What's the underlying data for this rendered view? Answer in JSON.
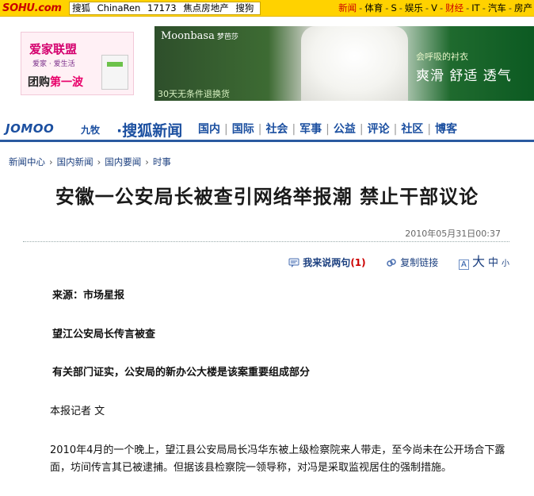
{
  "topbar": {
    "logo_prefix": "S",
    "logo_mid": "OHU",
    "logo_suffix": ".com",
    "left_links": [
      "搜狐",
      "ChinaRen",
      "17173",
      "焦点房地产",
      "搜狗"
    ],
    "right_links": [
      {
        "label": "新闻",
        "active": true
      },
      {
        "label": "体育",
        "active": false
      },
      {
        "label": "S",
        "active": false
      },
      {
        "label": "娱乐",
        "active": false
      },
      {
        "label": "V",
        "active": false
      },
      {
        "label": "财经",
        "active": true
      },
      {
        "label": "IT",
        "active": false
      },
      {
        "label": "汽车",
        "active": false
      },
      {
        "label": "房产",
        "active": false
      }
    ]
  },
  "ads": {
    "left": {
      "title": "爱家联盟",
      "tagline": "爱家 · 爱生活",
      "headline_a": "团购",
      "headline_b": "第一波"
    },
    "right": {
      "brand": "Moonbasa",
      "brand_cn": "梦芭莎",
      "subhead": "会呼吸的衬衣",
      "headline": "爽滑 舒适 透气",
      "footer": "30天无条件退换货"
    }
  },
  "nav": {
    "sponsor": "JOMOO",
    "sponsor_cn": "九牧",
    "site": "·搜狐新闻",
    "links": [
      "国内",
      "国际",
      "社会",
      "军事",
      "公益",
      "评论",
      "社区",
      "博客"
    ]
  },
  "breadcrumb": [
    "新闻中心",
    "国内新闻",
    "国内要闻",
    "时事"
  ],
  "article": {
    "title": "安徽一公安局长被查引网络举报潮 禁止干部议论",
    "timestamp": "2010年05月31日00:37",
    "tools": {
      "comment_label": "我来说两句",
      "comment_count": "(1)",
      "copy_label": "复制链接",
      "font_icon": "A",
      "font_large": "大",
      "font_medium": "中",
      "font_small": "小"
    },
    "source": "来源：市场星报",
    "subtitle1": "望江公安局长传言被查",
    "subtitle2": "有关部门证实，公安局的新办公大楼是该案重要组成部分",
    "byline": "本报记者  文",
    "body": "2010年4月的一个晚上，望江县公安局局长冯华东被上级检察院来人带走，至今尚未在公开场合下露面，坊间传言其已被逮捕。但据该县检察院一领导称，对冯是采取监视居住的强制措施。",
    "watermark": "",
    "watermark_sub": ""
  },
  "colors": {
    "topbar_bg": "#ffd200",
    "nav_blue": "#1b4fa0",
    "accent_red": "#cc0000"
  }
}
